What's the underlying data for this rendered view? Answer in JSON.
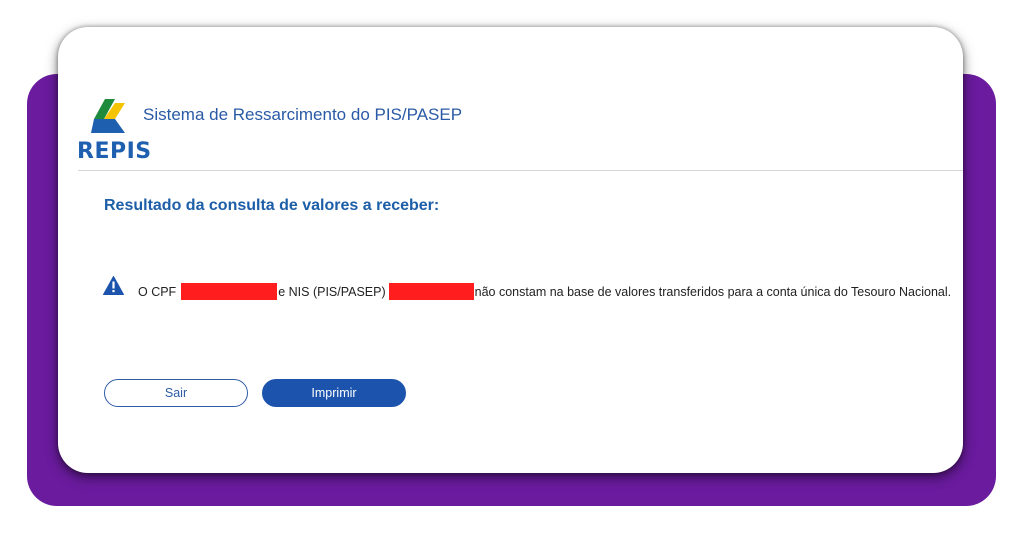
{
  "app": {
    "logo_text": "REPIS",
    "system_title": "Sistema de Ressarcimento do PIS/PASEP"
  },
  "result": {
    "heading": "Resultado da consulta de valores a receber:",
    "message_prefix": "O CPF",
    "message_middle": "e NIS (PIS/PASEP)",
    "message_suffix": "não constam na base de valores transferidos para a conta única do Tesouro Nacional.",
    "icon": "warning-icon"
  },
  "actions": {
    "sair_label": "Sair",
    "imprimir_label": "Imprimir"
  },
  "colors": {
    "backdrop": "#6a1b9e",
    "primary": "#1c54ad",
    "heading": "#1d5ea8",
    "redaction": "#ff1d1d",
    "logo_green": "#1e8a3c",
    "logo_yellow": "#f5c400",
    "logo_blue": "#1f5fb0"
  }
}
